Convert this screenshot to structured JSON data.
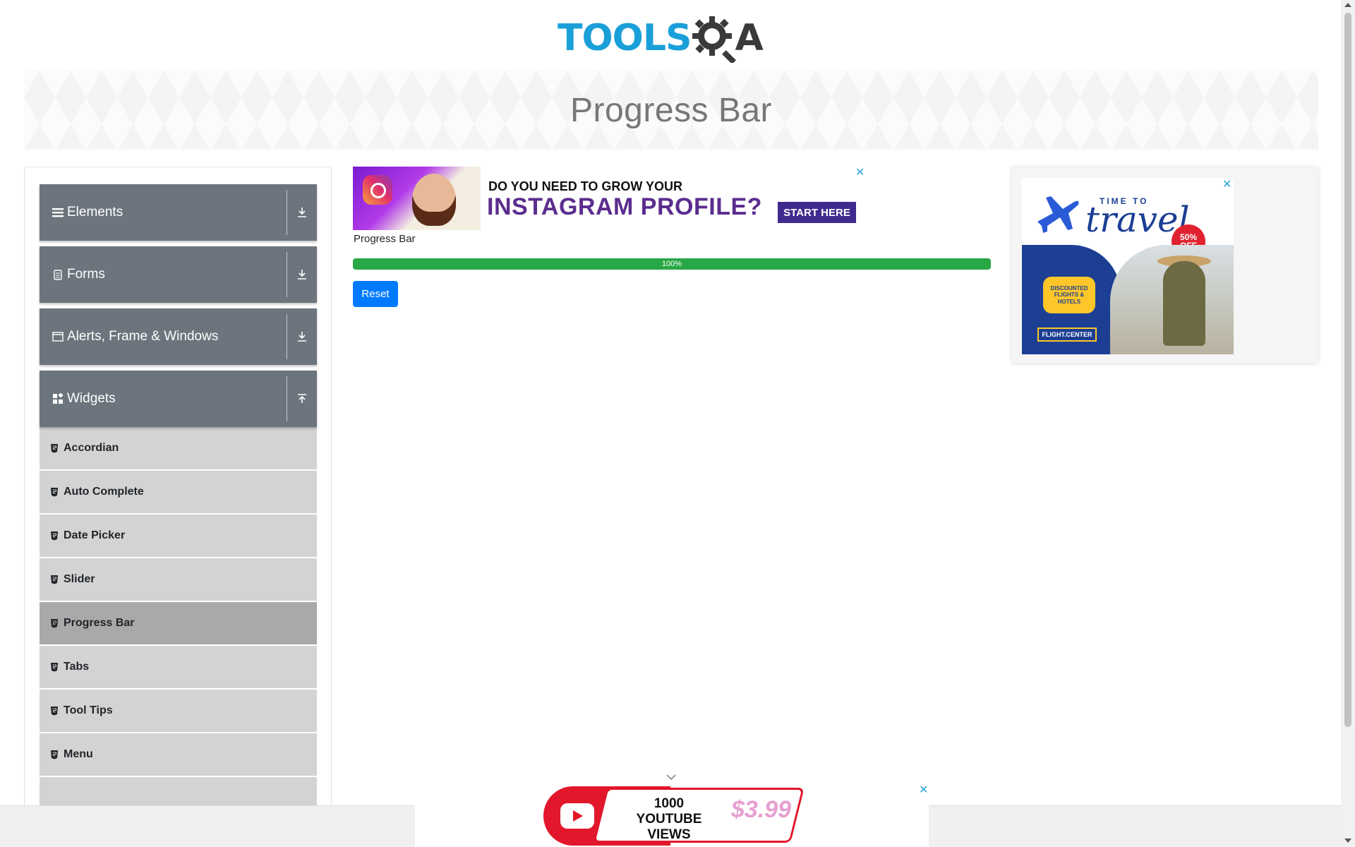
{
  "logo": {
    "part1": "TOOLS",
    "part2": "A"
  },
  "banner": {
    "title": "Progress Bar"
  },
  "sidebar": {
    "groups": [
      {
        "label": "Elements",
        "icon": "hamburger-icon",
        "toggle": "download-icon"
      },
      {
        "label": "Forms",
        "icon": "form-icon",
        "toggle": "download-icon"
      },
      {
        "label": "Alerts, Frame & Windows",
        "icon": "window-icon",
        "toggle": "download-icon"
      },
      {
        "label": "Widgets",
        "icon": "widgets-icon",
        "toggle": "upload-icon"
      }
    ],
    "widget_items": [
      {
        "label": "Accordian"
      },
      {
        "label": "Auto Complete"
      },
      {
        "label": "Date Picker"
      },
      {
        "label": "Slider"
      },
      {
        "label": "Progress Bar",
        "active": true
      },
      {
        "label": "Tabs"
      },
      {
        "label": "Tool Tips"
      },
      {
        "label": "Menu"
      }
    ]
  },
  "ad_top": {
    "line1": "DO YOU NEED TO GROW YOUR",
    "line2": "INSTAGRAM PROFILE?",
    "cta": "START HERE"
  },
  "main": {
    "label": "Progress Bar",
    "progress_value": 100,
    "progress_text": "100%",
    "reset_label": "Reset"
  },
  "ad_right": {
    "small": "TIME TO",
    "big": "travel",
    "badge_top": "50%",
    "badge_bottom": "OFF",
    "bubble": "DISCOUNTED FLIGHTS & HOTELS",
    "brand": "FLIGHT.CENTER"
  },
  "ad_bottom": {
    "views_num": "1000",
    "views_text": "YOUTUBE VIEWS",
    "price": "$3.99"
  },
  "colors": {
    "sidebar_header": "#6c757d",
    "menu_item": "#d3d3d3",
    "menu_item_active": "#a9a9a9",
    "progress": "#28a745",
    "button": "#007bff",
    "logo_blue": "#1a9fd9"
  }
}
